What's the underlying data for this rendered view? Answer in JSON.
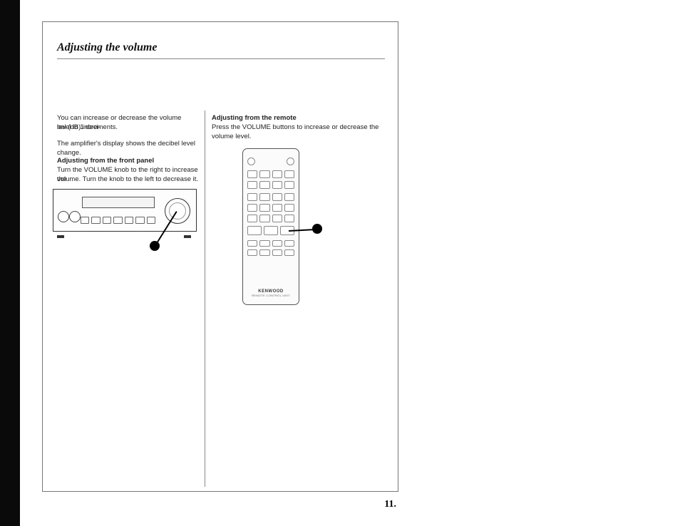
{
  "title": "Adjusting the volume",
  "intro_line1": "You can increase or decrease the volume level in 1 deci-",
  "intro_line2": "bel (dB) increments.",
  "intro_line3": "The amplifier's display shows the decibel level change.",
  "left_heading": "Adjusting from the front panel",
  "left_body1": "Turn the VOLUME knob to the right to increase the",
  "left_body2": "volume. Turn the knob to the left to decrease it.",
  "right_heading": "Adjusting from the remote",
  "right_body1": "Press the VOLUME buttons to increase or decrease the",
  "right_body2": "volume level.",
  "remote_brand": "KENWOOD",
  "remote_sub": "REMOTE CONTROL UNIT",
  "page_number": "11."
}
